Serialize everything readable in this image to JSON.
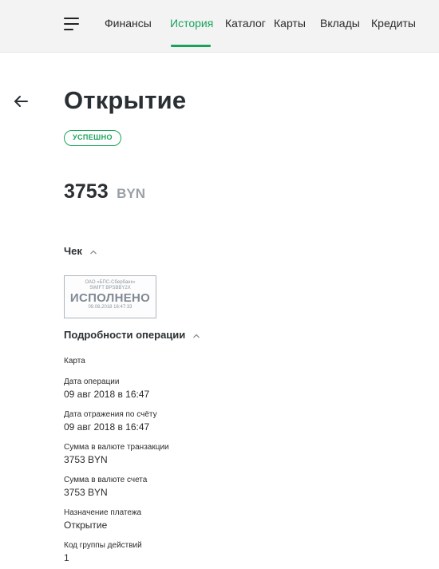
{
  "nav": {
    "items": [
      "Финансы",
      "История",
      "Каталог",
      "Карты",
      "Вклады",
      "Кредиты"
    ],
    "active": "История"
  },
  "page": {
    "title": "Открытие",
    "status": "УСПЕШНО",
    "amount": "3753",
    "currency": "BYN"
  },
  "receipt": {
    "heading": "Чек",
    "stamp": {
      "bank": "ОАО «БПС-Сбербанк»",
      "swift": "SWIFT BPSBBY2X",
      "status": "ИСПОЛНЕНО",
      "datetime": "09.08.2018 16:47:33"
    }
  },
  "details": {
    "heading": "Подробности операции",
    "card_label": "Карта",
    "fields": [
      {
        "label": "Дата операции",
        "value": "09 авг 2018 в 16:47"
      },
      {
        "label": "Дата отражения по счёту",
        "value": "09 авг 2018 в 16:47"
      },
      {
        "label": "Сумма в валюте транзакции",
        "value": "3753 BYN"
      },
      {
        "label": "Сумма в валюте счета",
        "value": "3753 BYN"
      },
      {
        "label": "Назначение платежа",
        "value": "Открытие"
      },
      {
        "label": "Код группы действий",
        "value": "1"
      }
    ]
  },
  "colors": {
    "accent": "#19a35a",
    "topbar_bg": "#f3f3f3",
    "text": "#2b2b2b",
    "muted": "#9aa0a6",
    "stamp": "#8d97a0"
  },
  "icons": [
    "menu-icon",
    "back-arrow-icon",
    "chevron-up-icon"
  ]
}
